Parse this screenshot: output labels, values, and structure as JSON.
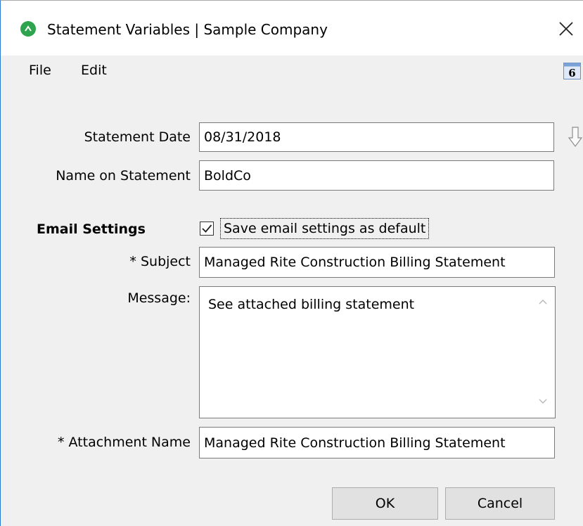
{
  "window": {
    "title": "Statement Variables  |  Sample Company",
    "close_glyph": "✕"
  },
  "menu": {
    "file": "File",
    "edit": "Edit"
  },
  "calendar_icon": {
    "day": "6"
  },
  "fields": {
    "statement_date": {
      "label": "Statement Date",
      "value": "08/31/2018"
    },
    "name_on_statement": {
      "label": "Name on Statement",
      "value": "BoldCo"
    }
  },
  "email_settings": {
    "section_label": "Email Settings",
    "save_default": {
      "label": "Save email settings as default",
      "checked": true
    },
    "subject": {
      "label": "* Subject",
      "value": "Managed Rite Construction Billing Statement"
    },
    "message": {
      "label": "Message:",
      "value": "See attached billing statement"
    },
    "attachment_name": {
      "label": "* Attachment Name",
      "value": "Managed Rite Construction Billing Statement"
    }
  },
  "buttons": {
    "ok": "OK",
    "cancel": "Cancel"
  },
  "colors": {
    "app_icon": "#2ea44f",
    "window_border": "#2b79d0",
    "dialog_background": "#f0f0f0"
  }
}
